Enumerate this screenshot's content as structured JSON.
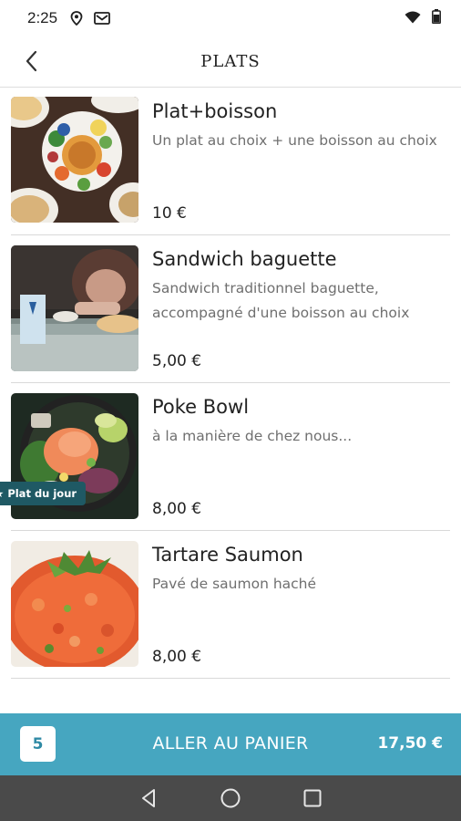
{
  "status_bar": {
    "time": "2:25",
    "icons": [
      "location-icon",
      "gmail-icon",
      "wifi-icon",
      "battery-icon"
    ]
  },
  "header": {
    "title": "PLATS",
    "back_icon": "chevron-left-icon"
  },
  "items": [
    {
      "name": "Plat+boisson",
      "description": "Un plat au choix + une boisson au choix",
      "price": "10 €",
      "image": "food-spread-photo"
    },
    {
      "name": "Sandwich baguette",
      "description": "Sandwich traditionnel baguette, accompagné d'une boisson au choix",
      "price": "5,00 €",
      "image": "cafe-table-photo"
    },
    {
      "name": "Poke Bowl",
      "description": "à la manière de chez nous...",
      "price": "8,00 €",
      "image": "poke-bowl-photo",
      "badge": "★ Plat du jour"
    },
    {
      "name": "Tartare Saumon",
      "description": "Pavé de saumon haché",
      "price": "8,00 €",
      "image": "salmon-tartare-photo"
    }
  ],
  "cart": {
    "count": "5",
    "label": "ALLER AU PANIER",
    "total": "17,50 €"
  },
  "colors": {
    "accent": "#46a6c0",
    "badge": "#1f5964",
    "nav_bar": "#4a4a4a"
  },
  "nav_bar": {
    "buttons": [
      "back-triangle-icon",
      "home-circle-icon",
      "recents-square-icon"
    ]
  }
}
